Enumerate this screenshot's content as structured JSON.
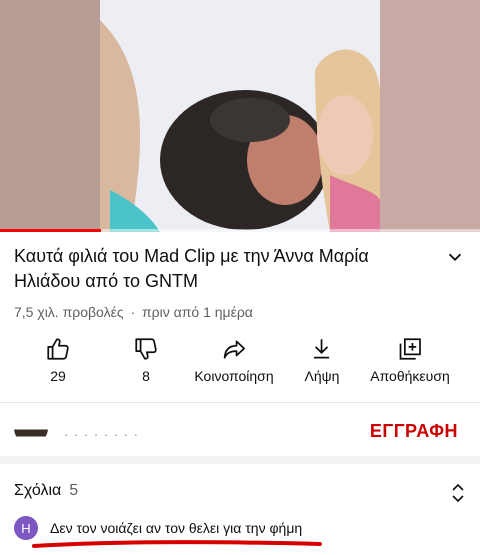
{
  "video": {
    "progress_fraction": 0.21,
    "progress_color": "#ff0000"
  },
  "title": "Καυτά φιλιά του Mad Clip με την Άννα Μαρία Ηλιάδου από το GNTM",
  "meta": {
    "views": "7,5 χιλ. προβολές",
    "separator": "·",
    "age": "πριν από 1 ημέρα"
  },
  "actions": [
    {
      "icon": "thumbs-up-icon",
      "label": "29"
    },
    {
      "icon": "thumbs-down-icon",
      "label": "8"
    },
    {
      "icon": "share-icon",
      "label": "Κοινοποίηση"
    },
    {
      "icon": "download-icon",
      "label": "Λήψη"
    },
    {
      "icon": "save-playlist-icon",
      "label": "Αποθήκευση"
    }
  ],
  "channel": {
    "name": "· · ·  · ·  · · ·",
    "subscribe_label": "ΕΓΓΡΑΦΗ",
    "subscribe_color": "#cc0000"
  },
  "comments": {
    "label": "Σχόλια",
    "count": "5",
    "top_comment": {
      "avatar_letter": "H",
      "avatar_color": "#7e57c2",
      "text": "Δεν τον νοιάζει αν τον θελει για την φήμη"
    }
  }
}
